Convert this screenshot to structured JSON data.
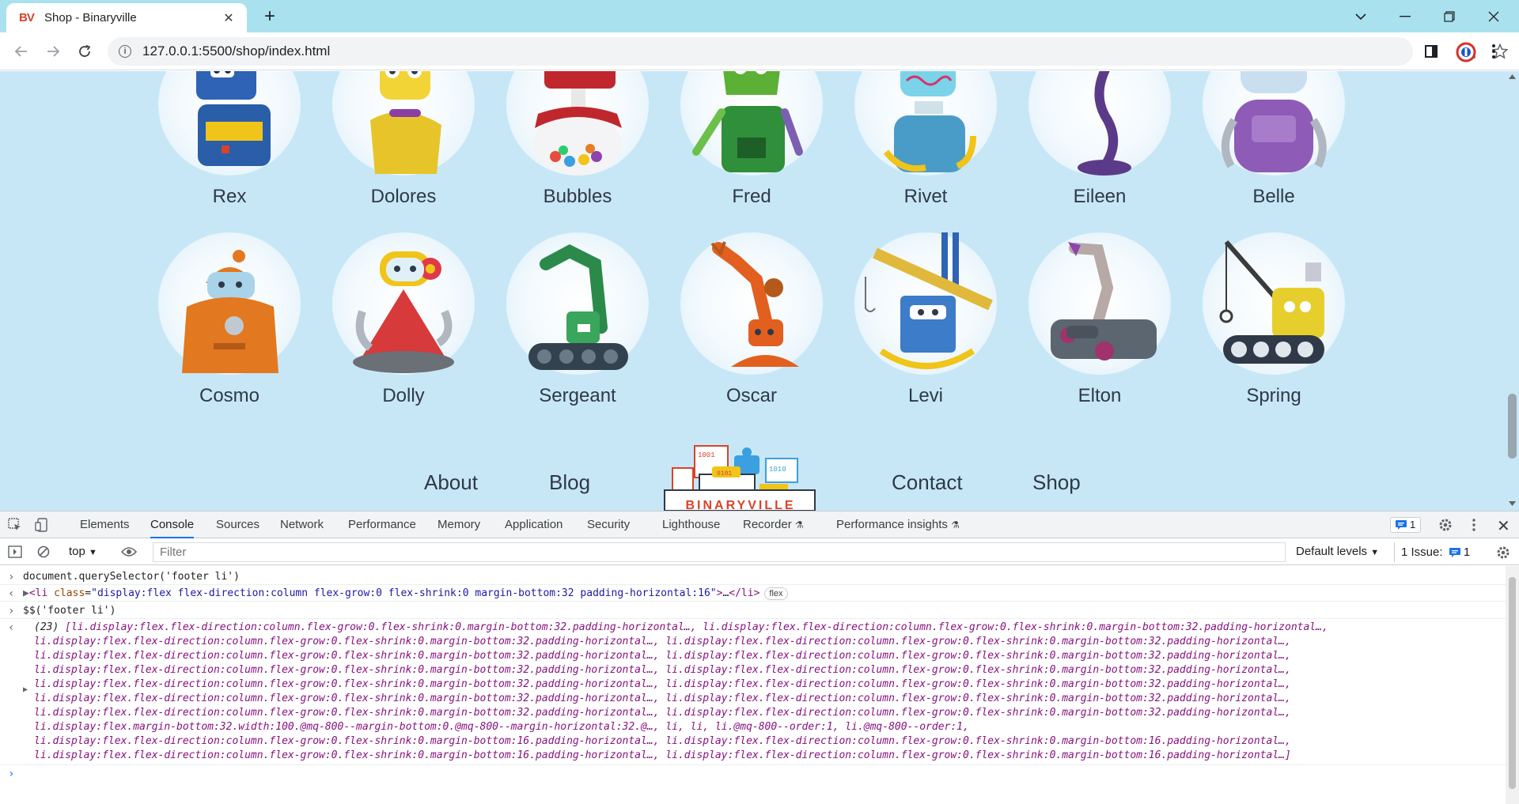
{
  "browser": {
    "tab_title": "Shop - Binaryville",
    "favicon_text": "BV",
    "url": "127.0.0.1:5500/shop/index.html"
  },
  "robots_row1": [
    "Rex",
    "Dolores",
    "Bubbles",
    "Fred",
    "Rivet",
    "Eileen",
    "Belle"
  ],
  "robots_row2": [
    "Cosmo",
    "Dolly",
    "Sergeant",
    "Oscar",
    "Levi",
    "Elton",
    "Spring"
  ],
  "footer": {
    "links": [
      "About",
      "Blog",
      "Contact",
      "Shop"
    ],
    "logo_text": "BINARYVILLE"
  },
  "devtools": {
    "tabs": [
      "Elements",
      "Console",
      "Sources",
      "Network",
      "Performance",
      "Memory",
      "Application",
      "Security",
      "Lighthouse",
      "Recorder",
      "Performance insights"
    ],
    "active_tab": "Console",
    "message_count": "1",
    "context": "top",
    "filter_placeholder": "Filter",
    "levels": "Default levels",
    "issues": "1 Issue:",
    "issues_count": "1",
    "console": {
      "cmd1": "document.querySelector('footer li')",
      "out1_class": "display:flex flex-direction:column flex-grow:0 flex-shrink:0 margin-bottom:32 padding-horizontal:16",
      "out1_badge": "flex",
      "cmd2": "$$('footer li')",
      "out2_count": "(23)",
      "out2_lines": [
        "[li.display:flex.flex-direction:column.flex-grow:0.flex-shrink:0.margin-bottom:32.padding-horizontal…, li.display:flex.flex-direction:column.flex-grow:0.flex-shrink:0.margin-bottom:32.padding-horizontal…,",
        "li.display:flex.flex-direction:column.flex-grow:0.flex-shrink:0.margin-bottom:32.padding-horizontal…, li.display:flex.flex-direction:column.flex-grow:0.flex-shrink:0.margin-bottom:32.padding-horizontal…,",
        "li.display:flex.flex-direction:column.flex-grow:0.flex-shrink:0.margin-bottom:32.padding-horizontal…, li.display:flex.flex-direction:column.flex-grow:0.flex-shrink:0.margin-bottom:32.padding-horizontal…,",
        "li.display:flex.flex-direction:column.flex-grow:0.flex-shrink:0.margin-bottom:32.padding-horizontal…, li.display:flex.flex-direction:column.flex-grow:0.flex-shrink:0.margin-bottom:32.padding-horizontal…,",
        "li.display:flex.flex-direction:column.flex-grow:0.flex-shrink:0.margin-bottom:32.padding-horizontal…, li.display:flex.flex-direction:column.flex-grow:0.flex-shrink:0.margin-bottom:32.padding-horizontal…,",
        "li.display:flex.flex-direction:column.flex-grow:0.flex-shrink:0.margin-bottom:32.padding-horizontal…, li.display:flex.flex-direction:column.flex-grow:0.flex-shrink:0.margin-bottom:32.padding-horizontal…,",
        "li.display:flex.flex-direction:column.flex-grow:0.flex-shrink:0.margin-bottom:32.padding-horizontal…, li.display:flex.flex-direction:column.flex-grow:0.flex-shrink:0.margin-bottom:32.padding-horizontal…,",
        "li.display:flex.margin-bottom:32.width:100.@mq-800--margin-bottom:0.@mq-800--margin-horizontal:32.@…, li, li, li.@mq-800--order:1, li.@mq-800--order:1,",
        "li.display:flex.flex-direction:column.flex-grow:0.flex-shrink:0.margin-bottom:16.padding-horizontal…, li.display:flex.flex-direction:column.flex-grow:0.flex-shrink:0.margin-bottom:16.padding-horizontal…,",
        "li.display:flex.flex-direction:column.flex-grow:0.flex-shrink:0.margin-bottom:16.padding-horizontal…, li.display:flex.flex-direction:column.flex-grow:0.flex-shrink:0.margin-bottom:16.padding-horizontal…]"
      ]
    }
  },
  "colors": {
    "page_bg": "#c7e7f7",
    "tabbar_bg": "#a9e2ee",
    "text_dark": "#2f3947",
    "accent_blue": "#1a73e8"
  }
}
